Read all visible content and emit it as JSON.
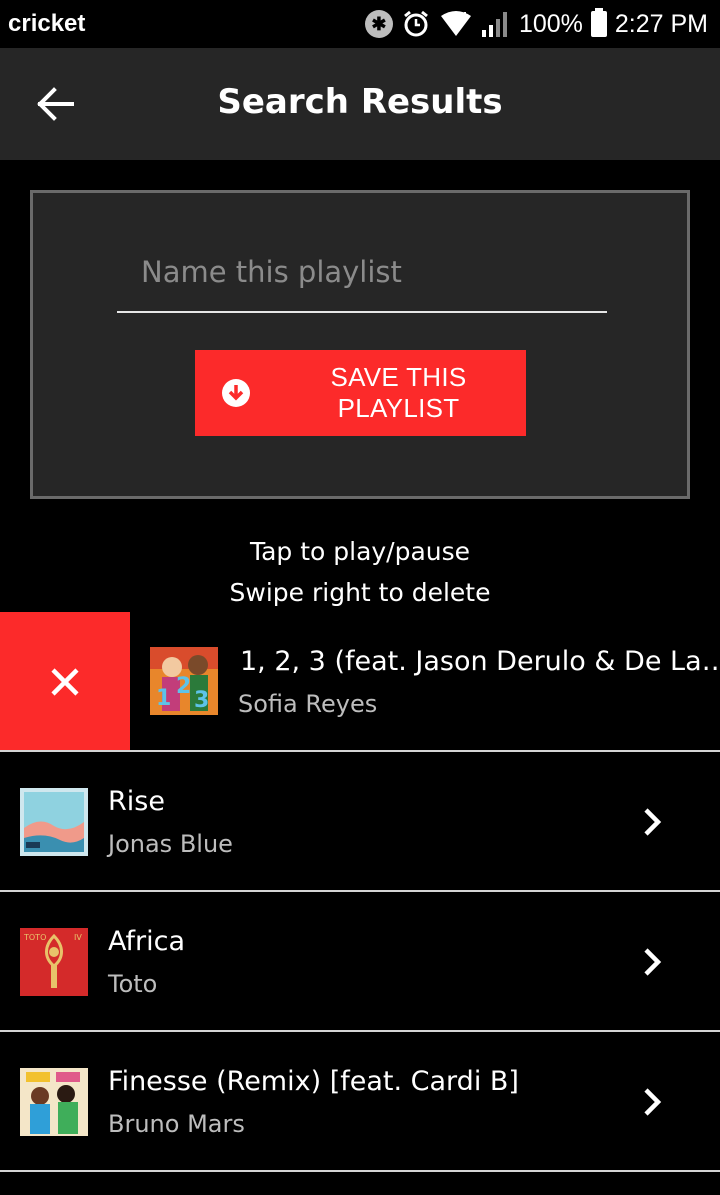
{
  "status_bar": {
    "carrier": "cricket",
    "battery": "100%",
    "time": "2:27 PM",
    "icons": [
      "bluetooth-icon",
      "alarm-icon",
      "wifi-icon",
      "signal-icon",
      "battery-icon"
    ]
  },
  "app_bar": {
    "title": "Search Results",
    "back_icon": "arrow-left-icon"
  },
  "save_panel": {
    "input_placeholder": "Name this playlist",
    "input_value": "",
    "save_label": "SAVE THIS PLAYLIST",
    "save_icon": "download-circle-icon"
  },
  "hints": {
    "line1": "Tap to play/pause",
    "line2": "Swipe right to delete"
  },
  "colors": {
    "accent": "#fc2a2a",
    "app_bar_bg": "#262626",
    "background": "#000000"
  },
  "tracks": [
    {
      "title": "1, 2, 3 (feat. Jason Derulo & De La…",
      "artist": "Sofia Reyes",
      "swiped": true
    },
    {
      "title": "Rise",
      "artist": "Jonas Blue",
      "swiped": false
    },
    {
      "title": "Africa",
      "artist": "Toto",
      "swiped": false
    },
    {
      "title": "Finesse (Remix) [feat. Cardi B]",
      "artist": "Bruno Mars",
      "swiped": false
    }
  ]
}
